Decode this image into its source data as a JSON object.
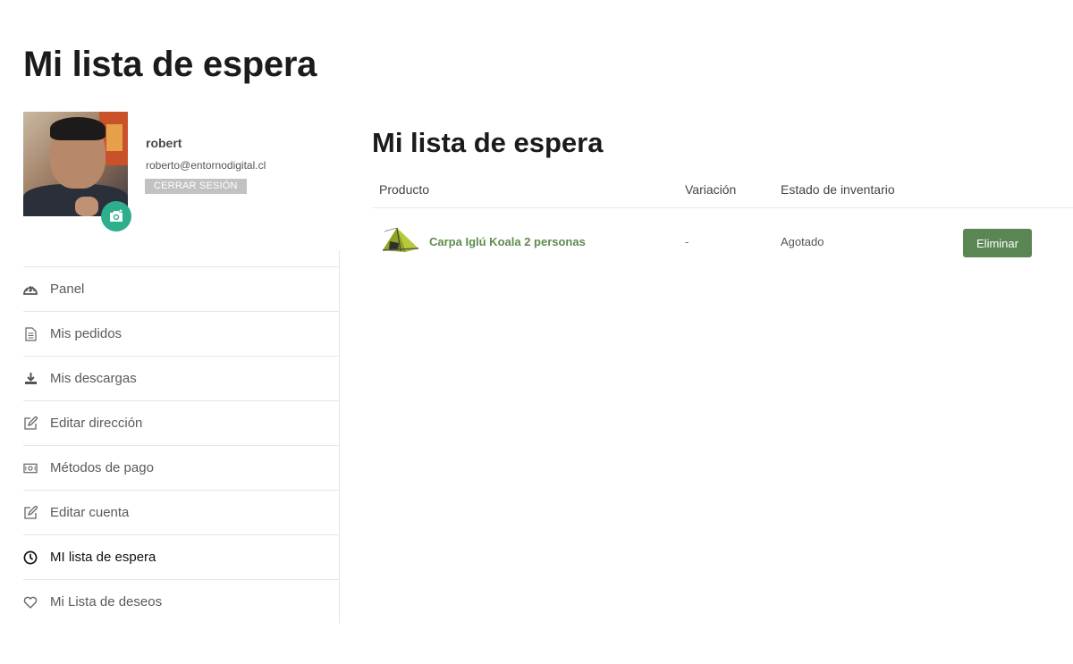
{
  "page": {
    "title": "Mi lista de espera"
  },
  "profile": {
    "name": "robert",
    "email": "roberto@entornodigital.cl",
    "logout_label": "CERRAR SESIÓN",
    "avatar_icon": "avatar-photo",
    "camera_icon": "camera-icon"
  },
  "nav": {
    "items": [
      {
        "label": "Panel",
        "icon": "dashboard-icon"
      },
      {
        "label": "Mis pedidos",
        "icon": "document-icon"
      },
      {
        "label": "Mis descargas",
        "icon": "download-icon"
      },
      {
        "label": "Editar dirección",
        "icon": "edit-icon"
      },
      {
        "label": "Métodos de pago",
        "icon": "money-icon"
      },
      {
        "label": "Editar cuenta",
        "icon": "edit-icon"
      },
      {
        "label": "MI lista de espera",
        "icon": "clock-icon",
        "active": true
      },
      {
        "label": "Mi Lista de deseos",
        "icon": "heart-icon"
      }
    ]
  },
  "content": {
    "title": "Mi lista de espera",
    "table": {
      "headers": [
        "Producto",
        "Variación",
        "Estado de inventario"
      ],
      "rows": [
        {
          "product": "Carpa Iglú Koala 2 personas",
          "variation": "-",
          "stock": "Agotado",
          "action": "Eliminar"
        }
      ]
    }
  },
  "colors": {
    "accent_green": "#5a8653",
    "link_green": "#5e8c4e",
    "camera_teal": "#2eae8c"
  }
}
